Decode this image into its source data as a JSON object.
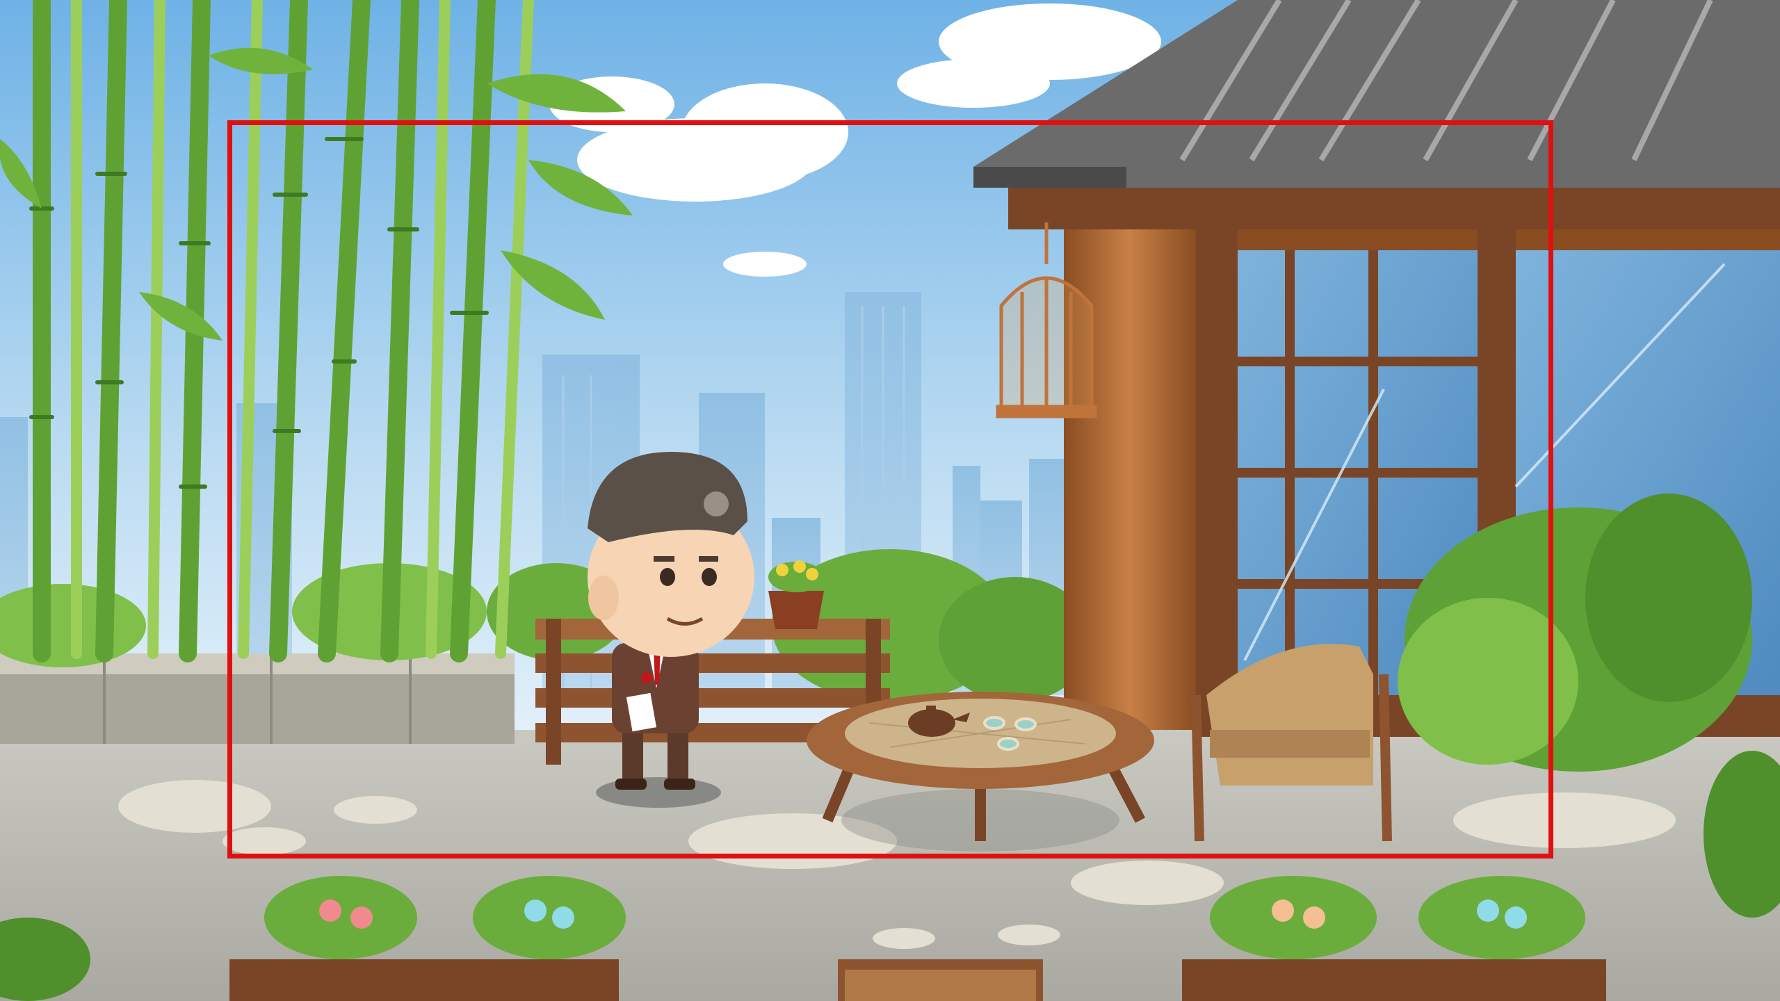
{
  "scene": {
    "name": "bamboo-courtyard-teahouse",
    "colors": {
      "sky_top": "#6fb2e6",
      "sky_bottom": "#e6f2fb",
      "bamboo": "#5fa233",
      "wood": "#9a5a2c",
      "stone": "#b8b3a6",
      "frame_highlight": "#e01010"
    },
    "icons": [
      "bamboo",
      "birdcage",
      "teapot",
      "tea-cup",
      "rattan-chair",
      "flower-pot",
      "character"
    ]
  },
  "highlight_frame": {
    "color": "#e01010",
    "shown": true
  }
}
